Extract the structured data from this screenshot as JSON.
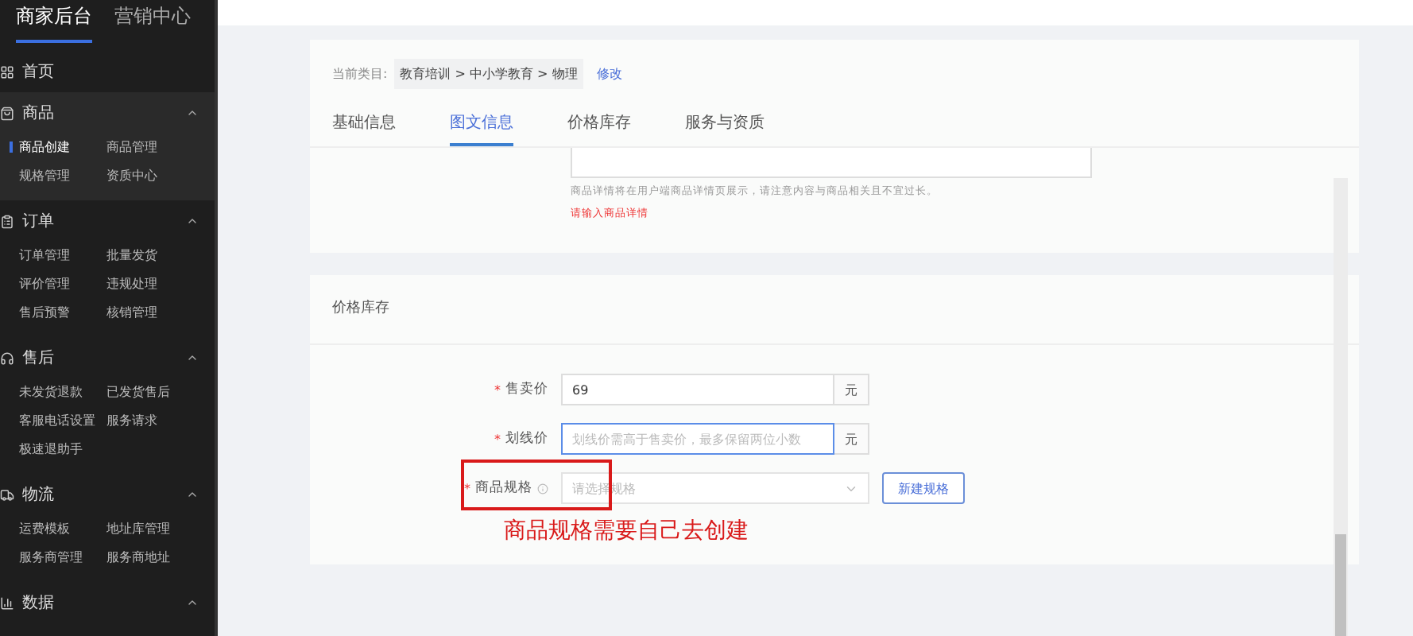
{
  "sidebar": {
    "top_tabs": [
      {
        "label": "商家后台",
        "selected": true
      },
      {
        "label": "营销中心",
        "selected": false
      }
    ],
    "groups": [
      {
        "label": "首页",
        "expanded": false
      },
      {
        "label": "商品",
        "expanded": true,
        "children": [
          {
            "label": "商品创建",
            "selected": true
          },
          {
            "label": "商品管理",
            "selected": false
          },
          {
            "label": "规格管理",
            "selected": false
          },
          {
            "label": "资质中心",
            "selected": false
          }
        ]
      },
      {
        "label": "订单",
        "expanded": true,
        "children": [
          {
            "label": "订单管理",
            "selected": false
          },
          {
            "label": "批量发货",
            "selected": false
          },
          {
            "label": "评价管理",
            "selected": false
          },
          {
            "label": "违规处理",
            "selected": false
          },
          {
            "label": "售后预警",
            "selected": false
          },
          {
            "label": "核销管理",
            "selected": false
          }
        ]
      },
      {
        "label": "售后",
        "expanded": true,
        "children": [
          {
            "label": "未发货退款",
            "selected": false
          },
          {
            "label": "已发货售后",
            "selected": false
          },
          {
            "label": "客服电话设置",
            "selected": false
          },
          {
            "label": "服务请求",
            "selected": false
          },
          {
            "label": "极速退助手",
            "selected": false
          }
        ]
      },
      {
        "label": "物流",
        "expanded": true,
        "children": [
          {
            "label": "运费模板",
            "selected": false
          },
          {
            "label": "地址库管理",
            "selected": false
          },
          {
            "label": "服务商管理",
            "selected": false
          },
          {
            "label": "服务商地址",
            "selected": false
          }
        ]
      },
      {
        "label": "数据",
        "expanded": true
      }
    ]
  },
  "category": {
    "label": "当前类目:",
    "path": "教育培训 > 中小学教育 > 物理",
    "edit_link": "修改"
  },
  "tabs": [
    {
      "label": "基础信息",
      "selected": false
    },
    {
      "label": "图文信息",
      "selected": true
    },
    {
      "label": "价格库存",
      "selected": false
    },
    {
      "label": "服务与资质",
      "selected": false
    }
  ],
  "detail": {
    "hint": "商品详情将在用户端商品详情页展示，请注意内容与商品相关且不宜过长。",
    "error": "请输入商品详情"
  },
  "price_section": {
    "title": "价格库存",
    "fields": [
      {
        "kind": "input",
        "label": "售卖价",
        "required_mark": "*",
        "value": "69",
        "suffix": "元",
        "focused": false
      },
      {
        "kind": "input",
        "label": "划线价",
        "required_mark": "*",
        "placeholder": "划线价需高于售卖价，最多保留两位小数",
        "suffix": "元",
        "focused": true
      },
      {
        "kind": "select",
        "label": "商品规格",
        "required_mark": "*",
        "info": true,
        "placeholder": "请选择规格",
        "button": "新建规格",
        "highlighted": true
      }
    ]
  },
  "annotation": "商品规格需要自己去创建"
}
